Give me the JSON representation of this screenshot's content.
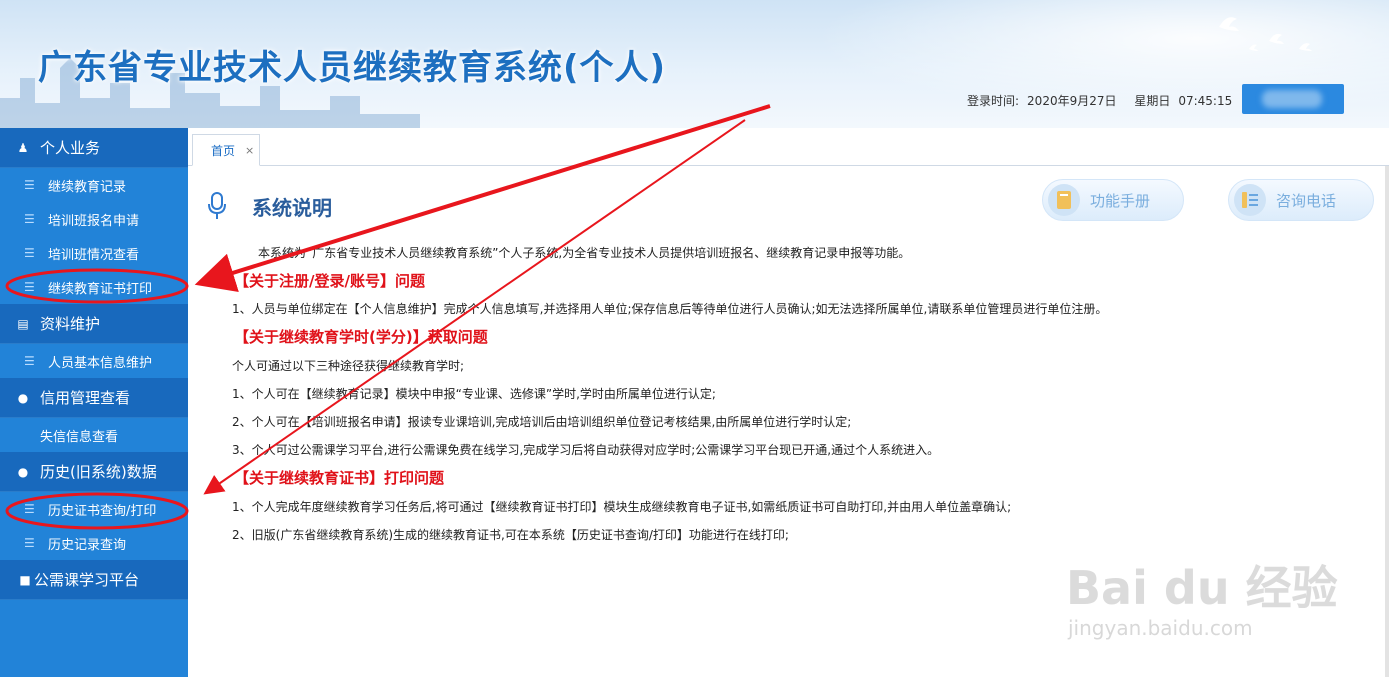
{
  "header": {
    "title": "广东省专业技术人员继续教育系统(个人)",
    "login_time_label": "登录时间:",
    "login_date": "2020年9月27日",
    "weekday": "星期日",
    "time": "07:45:15"
  },
  "sidebar": {
    "groups": [
      {
        "label": "个人业务",
        "icon": "person-icon",
        "items": [
          "继续教育记录",
          "培训班报名申请",
          "培训班情况查看",
          "继续教育证书打印"
        ]
      },
      {
        "label": "资料维护",
        "icon": "book-icon",
        "items": [
          "人员基本信息维护"
        ]
      },
      {
        "label": "信用管理查看",
        "icon": "bulb-icon",
        "items": [
          "失信信息查看"
        ]
      },
      {
        "label": "历史(旧系统)数据",
        "icon": "bulb-icon",
        "items": [
          "历史证书查询/打印",
          "历史记录查询"
        ]
      },
      {
        "label": "公需课学习平台",
        "icon": "square-icon",
        "items": []
      }
    ]
  },
  "tabs": [
    {
      "label": "首页",
      "close": "×"
    }
  ],
  "main": {
    "section_title": "系统说明",
    "btn_manual": "功能手册",
    "btn_phone": "咨询电话",
    "intro": "本系统为“广东省专业技术人员继续教育系统”个人子系统,为全省专业技术人员提供培训班报名、继续教育记录申报等功能。",
    "h1": "【关于注册/登录/账号】问题",
    "p1": "1、人员与单位绑定在【个人信息维护】完成个人信息填写,并选择用人单位;保存信息后等待单位进行人员确认;如无法选择所属单位,请联系单位管理员进行单位注册。",
    "h2": "【关于继续教育学时(学分)】获取问题",
    "p2": "个人可通过以下三种途径获得继续教育学时;",
    "p3": "1、个人可在【继续教育记录】模块中申报“专业课、选修课”学时,学时由所属单位进行认定;",
    "p4": "2、个人可在【培训班报名申请】报读专业课培训,完成培训后由培训组织单位登记考核结果,由所属单位进行学时认定;",
    "p5": "3、个人可过公需课学习平台,进行公需课免费在线学习,完成学习后将自动获得对应学时;公需课学习平台现已开通,通过个人系统进入。",
    "h3": "【关于继续教育证书】打印问题",
    "p6": "1、个人完成年度继续教育学习任务后,将可通过【继续教育证书打印】模块生成继续教育电子证书,如需纸质证书可自助打印,并由用人单位盖章确认;",
    "p7": "2、旧版(广东省继续教育系统)生成的继续教育证书,可在本系统【历史证书查询/打印】功能进行在线打印;"
  },
  "watermark": {
    "logo": "Bai du 经验",
    "url": "jingyan.baidu.com"
  },
  "colors": {
    "sidebar": "#2283d8",
    "sidebar_group": "#1869bd",
    "title": "#1d6fc0",
    "red": "#e0121a",
    "annotation": "#e8161d"
  }
}
